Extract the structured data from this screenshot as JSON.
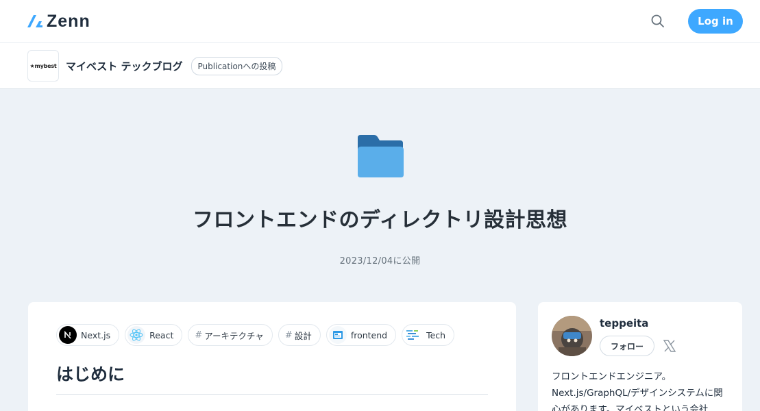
{
  "header": {
    "logo_text": "Zenn",
    "login_label": "Log in",
    "accent": "#3ea8ff"
  },
  "publication": {
    "avatar_text": "mybest",
    "name": "マイベスト テックブログ",
    "badge": "Publicationへの投稿"
  },
  "article": {
    "emoji": "folder",
    "title": "フロントエンドのディレクトリ設計思想",
    "date": "2023/12/04に公開",
    "tags": [
      {
        "label": "Next.js",
        "icon": "nextjs-icon"
      },
      {
        "label": "React",
        "icon": "react-icon"
      },
      {
        "label": "アーキテクチャ",
        "icon": "hash"
      },
      {
        "label": "設計",
        "icon": "hash"
      },
      {
        "label": "frontend",
        "icon": "frontend-icon"
      },
      {
        "label": "Tech",
        "icon": "tech-icon"
      }
    ],
    "section_heading": "はじめに"
  },
  "author": {
    "name": "teppeita",
    "follow_label": "フォロー",
    "bio_line1": "フロントエンドエンジニア。",
    "bio_line2": "Next.js/GraphQL/デザインシステムに関",
    "bio_line3": "心があります。マイベストという会社"
  }
}
